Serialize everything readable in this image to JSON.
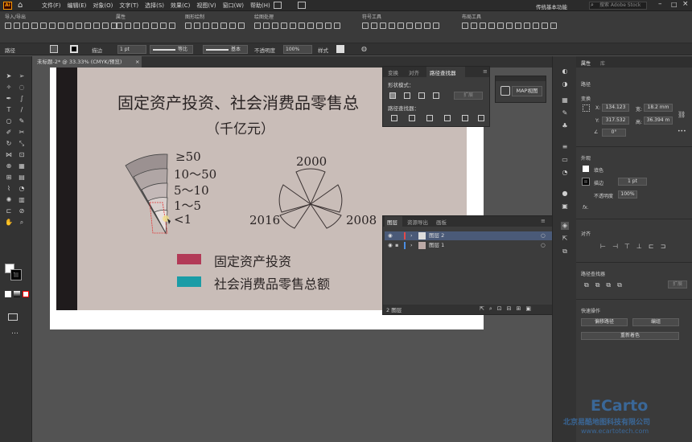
{
  "app": {
    "logo": "Ai",
    "workspace": "传统基本功能",
    "search_placeholder": "搜索 Adobe Stock"
  },
  "menu": [
    "文件(F)",
    "编辑(E)",
    "对象(O)",
    "文字(T)",
    "选择(S)",
    "效果(C)",
    "视图(V)",
    "窗口(W)",
    "帮助(H)"
  ],
  "toolbar_groups": [
    "导入/导出",
    "属性",
    "图形绘制",
    "绘图处理",
    "符号工具",
    "布局工具"
  ],
  "control": {
    "label_path": "路径",
    "stroke_label": "描边",
    "stroke_value": "1 pt",
    "uniform": "等比",
    "basic": "基本",
    "opacity_label": "不透明度",
    "opacity_value": "100%",
    "style_label": "样式"
  },
  "document_tab": "未标题-2* @ 33.33% (CMYK/预览)",
  "chart": {
    "title": "固定资产投资、社会消费品零售总",
    "unit": "（千亿元）",
    "legend_levels": [
      "≥50",
      "10～50",
      "5～10",
      "1～5",
      "<1"
    ],
    "years": [
      "2000",
      "2016",
      "2008"
    ],
    "series": [
      {
        "name": "固定资产投资",
        "color": "#b23a57"
      },
      {
        "name": "社会消费品零售总额",
        "color": "#1a9ca6"
      }
    ]
  },
  "pathfinder": {
    "tabs": [
      "变换",
      "对齐",
      "路径查找器"
    ],
    "shape_modes": "形状模式：",
    "pathfinders": "路径查找器：",
    "expand": "扩展"
  },
  "mapbox": {
    "label": "MAP视图"
  },
  "layers": {
    "tabs": [
      "图层",
      "资源导出",
      "画板"
    ],
    "rows": [
      "图层 2",
      "图层 1"
    ],
    "count": "2 图层"
  },
  "properties": {
    "tabs": [
      "属性",
      "库"
    ],
    "section_path": "路径",
    "transform": "变换",
    "x_label": "X:",
    "x": "134.123",
    "y_label": "Y:",
    "y": "317.532",
    "w_label": "宽:",
    "w": "18.2 mm",
    "h_label": "高:",
    "h": "36.394 m",
    "angle": "0°",
    "appearance": "外观",
    "fill": "填色",
    "stroke": "描边",
    "stroke_value": "1 pt",
    "opacity": "不透明度",
    "opacity_value": "100%",
    "fx": "fx.",
    "align": "对齐",
    "pathfinder": "路径查找器",
    "expand": "扩展",
    "quick": "快速操作",
    "offset_path": "偏移路径",
    "edit": "编组",
    "recolor": "重新着色"
  },
  "watermark": {
    "brand": "ECarto",
    "company": "北京易酷地图科技有限公司",
    "url": "www.ecartotech.com"
  }
}
